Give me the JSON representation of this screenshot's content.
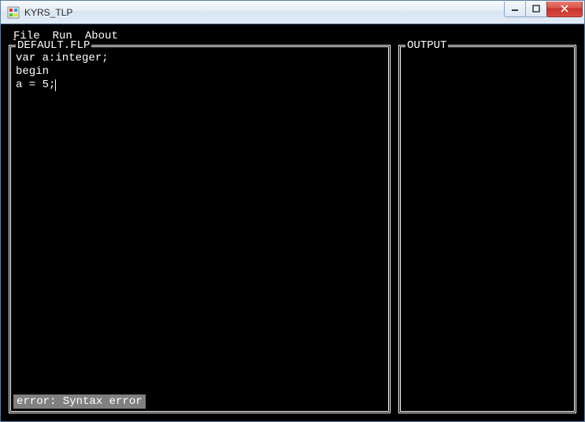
{
  "window": {
    "title": "KYRS_TLP"
  },
  "menu": {
    "file": "File",
    "run": "Run",
    "about": "About"
  },
  "editor": {
    "title": "DEFAULT.FLP",
    "content": "var a:integer;\nbegin\na = 5;",
    "status": "error: Syntax error"
  },
  "output": {
    "title": "OUTPUT",
    "content": ""
  }
}
